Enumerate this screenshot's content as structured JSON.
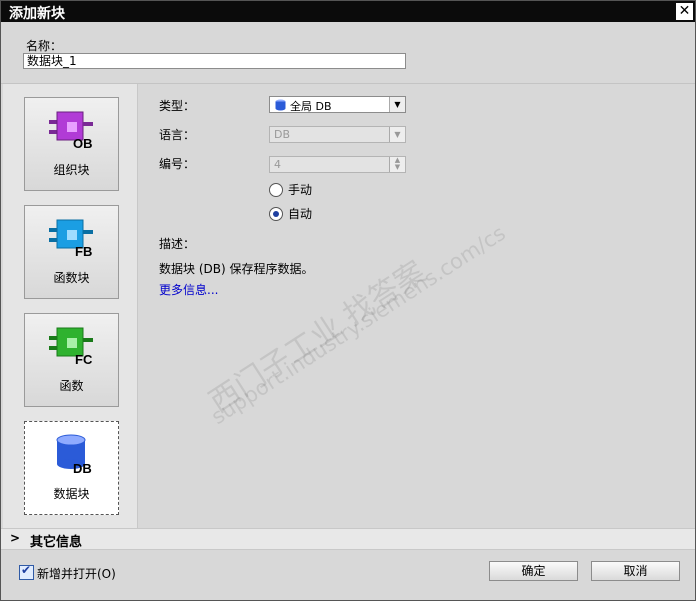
{
  "titlebar": {
    "title": "添加新块",
    "close_icon": "close-icon"
  },
  "name": {
    "label": "名称：",
    "value": "数据块_1"
  },
  "blocks": [
    {
      "label": "组织块",
      "icon": "ob-block-icon",
      "badge": "OB"
    },
    {
      "label": "函数块",
      "icon": "fb-block-icon",
      "badge": "FB"
    },
    {
      "label": "函数",
      "icon": "fc-block-icon",
      "badge": "FC"
    },
    {
      "label": "数据块",
      "icon": "db-block-icon",
      "badge": "DB",
      "selected": true
    }
  ],
  "props": {
    "type_label": "类型：",
    "type_value": "全局 DB",
    "lang_label": "语言：",
    "lang_value": "DB",
    "number_label": "编号：",
    "number_value": "4",
    "radio_manual": "手动",
    "radio_auto": "自动",
    "desc_label": "描述：",
    "desc_text": "数据块 (DB) 保存程序数据。",
    "more_link": "更多信息..."
  },
  "watermark": {
    "line1": "西门子工业  找答案",
    "line2": "support.industry.siemens.com/cs"
  },
  "more_info": {
    "label": "其它信息"
  },
  "footer": {
    "checkbox_label": "新增并打开(O)",
    "ok": "确定",
    "cancel": "取消"
  },
  "colors": {
    "ob": "#b13bd6",
    "fb": "#1b9ee3",
    "fc": "#2fb22f",
    "db": "#2b5bd8"
  }
}
